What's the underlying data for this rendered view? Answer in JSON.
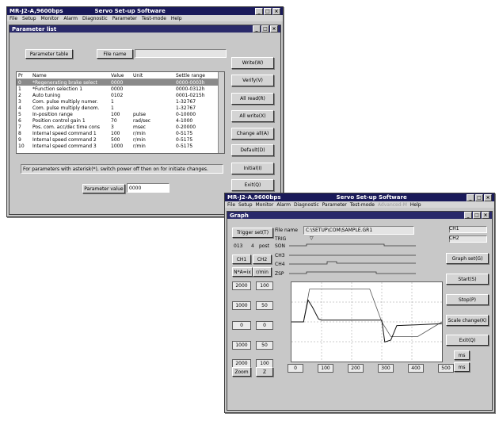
{
  "win1": {
    "title": "MR-J2-A,9600bps",
    "app": "Servo Set-up Software",
    "menu": [
      "File",
      "Setup",
      "Monitor",
      "Alarm",
      "Diagnostic",
      "Parameter",
      "Test-mode",
      "Help"
    ],
    "child_title": "Parameter list",
    "btn_param_table": "Parameter table",
    "btn_file_name": "File name",
    "columns": [
      "Pr",
      "Name",
      "Value",
      "Unit",
      "Settle range"
    ],
    "rows": [
      [
        "0",
        "*Regenerating brake select",
        "0000",
        "",
        "0000-0003h"
      ],
      [
        "1",
        "*Function selection 1",
        "0000",
        "",
        "0000-0312h"
      ],
      [
        "2",
        "Auto tuning",
        "0102",
        "",
        "0001-0215h"
      ],
      [
        "3",
        "Com. pulse multiply numer.",
        "1",
        "",
        "1-32767"
      ],
      [
        "4",
        "Com. pulse multiply denom.",
        "1",
        "",
        "1-32767"
      ],
      [
        "5",
        "In-position range",
        "100",
        "pulse",
        "0-10000"
      ],
      [
        "6",
        "Position control gain 1",
        "70",
        "rad/sec",
        "4-1000"
      ],
      [
        "7",
        "Pos. com. acc/dec time cons",
        "3",
        "msec",
        "0-20000"
      ],
      [
        "8",
        "Internal speed command 1",
        "100",
        "r/min",
        "0-5175"
      ],
      [
        "9",
        "Internal speed command 2",
        "500",
        "r/min",
        "0-5175"
      ],
      [
        "10",
        "Internal speed command 3",
        "1000",
        "r/min",
        "0-5175"
      ]
    ],
    "side_buttons": [
      "Write(W)",
      "Verify(V)",
      "All read(R)",
      "All write(X)",
      "Change all(A)",
      "Default(D)",
      "Initial(I)",
      "Exit(Q)"
    ],
    "notice": "For parameters with asterisk(*), switch power off then on for initiate changes.",
    "param_value_label": "Parameter value",
    "param_value": "0000"
  },
  "win2": {
    "title": "MR-J2-A,9600bps",
    "app": "Servo Set-up Software",
    "menu": [
      "File",
      "Setup",
      "Monitor",
      "Alarm",
      "Diagnostic",
      "Parameter",
      "Test-mode",
      "Advanced-M"
    ],
    "menu_extra": "Help",
    "child_title": "Graph",
    "trigger_btn": "Trigger set(T)",
    "file_label": "File name",
    "file_value": "C:\\SETUP\\COM\\SAMPLE.GR1",
    "trig_label": "TRIG",
    "ch_labels": [
      "SON",
      "CH3",
      "CH4",
      "ZSP"
    ],
    "ch_btns": [
      "CH1",
      "CH2"
    ],
    "ch_inputs": [
      "CH1",
      "CH2"
    ],
    "post_label": "post",
    "post_val": "013",
    "fraction": "4",
    "units": [
      "N*A=ix",
      "r/min"
    ],
    "scale_left": [
      "2000",
      "1000",
      "0",
      "1000",
      "2000"
    ],
    "scale_right": [
      "100",
      "50",
      "0",
      "50",
      "100"
    ],
    "xticks": [
      "0",
      "100",
      "200",
      "300",
      "400",
      "500"
    ],
    "right_btns": [
      "Graph set(G)",
      "Start(S)",
      "Stop(P)",
      "Scale change(K)",
      "Exit(Q)"
    ],
    "time_units": [
      "ms",
      "ms"
    ],
    "bottom_btns": [
      "Zoom",
      "Z"
    ]
  },
  "chart_data": {
    "type": "line",
    "xlabel": "",
    "ylabel": "",
    "xlim": [
      0,
      500
    ],
    "x_ticks": [
      "0",
      "100",
      "200",
      "300",
      "400",
      "500"
    ],
    "grid": true,
    "series": [
      {
        "x": [
          0,
          40,
          60,
          80,
          260,
          300,
          330,
          420,
          500
        ],
        "y": [
          0,
          0,
          90,
          90,
          90,
          0,
          -40,
          -40,
          0
        ]
      },
      {
        "x": [
          0,
          40,
          55,
          70,
          90,
          100,
          250,
          270,
          300,
          310,
          330,
          350,
          420,
          500
        ],
        "y": [
          0,
          0,
          60,
          40,
          8,
          5,
          5,
          5,
          5,
          -55,
          -50,
          -10,
          -8,
          -5
        ]
      }
    ]
  }
}
